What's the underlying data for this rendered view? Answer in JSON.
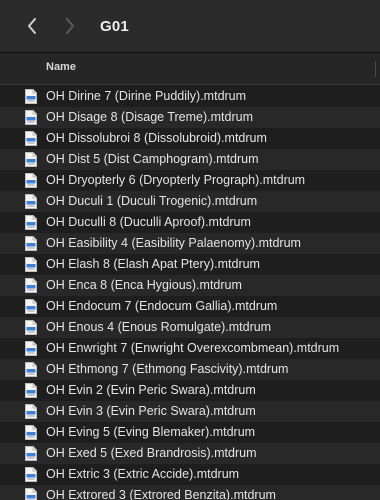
{
  "toolbar": {
    "title": "G01",
    "back_icon": "chevron-left-icon",
    "forward_icon": "chevron-right-icon"
  },
  "columns": {
    "name": "Name"
  },
  "colors": {
    "background": "#1e1e1e",
    "row_alt": "#282828",
    "toolbar": "#2b2b2b",
    "text": "#e4e4e4",
    "icon_accent": "#3b82d6"
  },
  "files": [
    {
      "name": "OH Dirine 7 (Dirine Puddily).mtdrum",
      "icon": "document-icon"
    },
    {
      "name": "OH Disage 8 (Disage Treme).mtdrum",
      "icon": "document-icon"
    },
    {
      "name": "OH Dissolubroi 8 (Dissolubroid).mtdrum",
      "icon": "document-icon"
    },
    {
      "name": "OH Dist 5 (Dist Camphogram).mtdrum",
      "icon": "document-icon"
    },
    {
      "name": "OH Dryopterly 6 (Dryopterly Prograph).mtdrum",
      "icon": "document-icon"
    },
    {
      "name": "OH Duculi 1 (Duculi Trogenic).mtdrum",
      "icon": "document-icon"
    },
    {
      "name": "OH Duculli 8 (Duculli Aproof).mtdrum",
      "icon": "document-icon"
    },
    {
      "name": "OH Easibility 4 (Easibility Palaenomy).mtdrum",
      "icon": "document-icon"
    },
    {
      "name": "OH Elash 8 (Elash Apat Ptery).mtdrum",
      "icon": "document-icon"
    },
    {
      "name": "OH Enca 8 (Enca Hygious).mtdrum",
      "icon": "document-icon"
    },
    {
      "name": "OH Endocum 7 (Endocum Gallia).mtdrum",
      "icon": "document-icon"
    },
    {
      "name": "OH Enous 4 (Enous Romulgate).mtdrum",
      "icon": "document-icon"
    },
    {
      "name": "OH Enwright 7 (Enwright Overexcombmean).mtdrum",
      "icon": "document-icon"
    },
    {
      "name": "OH Ethmong 7 (Ethmong Fascivity).mtdrum",
      "icon": "document-icon"
    },
    {
      "name": "OH Evin 2 (Evin Peric Swara).mtdrum",
      "icon": "document-icon"
    },
    {
      "name": "OH Evin 3 (Evin Peric Swara).mtdrum",
      "icon": "document-icon"
    },
    {
      "name": "OH Eving 5 (Eving Blemaker).mtdrum",
      "icon": "document-icon"
    },
    {
      "name": "OH Exed 5 (Exed Brandrosis).mtdrum",
      "icon": "document-icon"
    },
    {
      "name": "OH Extric 3 (Extric Accide).mtdrum",
      "icon": "document-icon"
    },
    {
      "name": "OH Extrored 3 (Extrored Benzita).mtdrum",
      "icon": "document-icon"
    }
  ]
}
